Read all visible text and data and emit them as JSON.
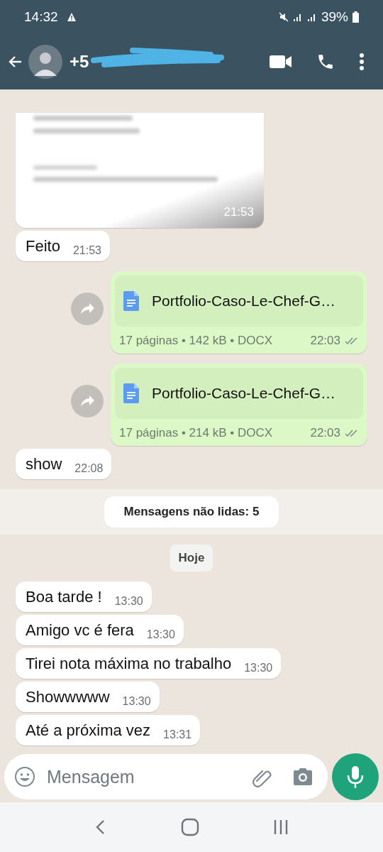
{
  "status_bar": {
    "time": "14:32",
    "battery": "39%"
  },
  "header": {
    "title": "+5"
  },
  "messages": [
    {
      "kind": "blurred",
      "time": "21:53"
    },
    {
      "kind": "text",
      "outgoing": false,
      "text": "Feito",
      "time": "21:53"
    },
    {
      "kind": "document",
      "outgoing": true,
      "name": "Portfolio-Caso-Le-Chef-G…",
      "meta": "17 páginas • 142 kB • DOCX",
      "time": "22:03",
      "read": false
    },
    {
      "kind": "document",
      "outgoing": true,
      "name": "Portfolio-Caso-Le-Chef-G…",
      "meta": "17 páginas • 214 kB • DOCX",
      "time": "22:03",
      "read": false
    },
    {
      "kind": "text",
      "outgoing": false,
      "text": "show",
      "time": "22:08"
    },
    {
      "kind": "unread",
      "text": "Mensagens não lidas: 5"
    },
    {
      "kind": "date",
      "text": "Hoje"
    },
    {
      "kind": "text",
      "outgoing": false,
      "text": "Boa tarde !",
      "time": "13:30"
    },
    {
      "kind": "text",
      "outgoing": false,
      "text": "Amigo vc é fera",
      "time": "13:30"
    },
    {
      "kind": "text",
      "outgoing": false,
      "text": "Tirei nota máxima no trabalho",
      "time": "13:30"
    },
    {
      "kind": "text",
      "outgoing": false,
      "text": "Showwwww",
      "time": "13:30"
    },
    {
      "kind": "text",
      "outgoing": false,
      "text": "Até a próxima vez",
      "time": "13:31"
    }
  ],
  "composer": {
    "placeholder": "Mensagem"
  }
}
